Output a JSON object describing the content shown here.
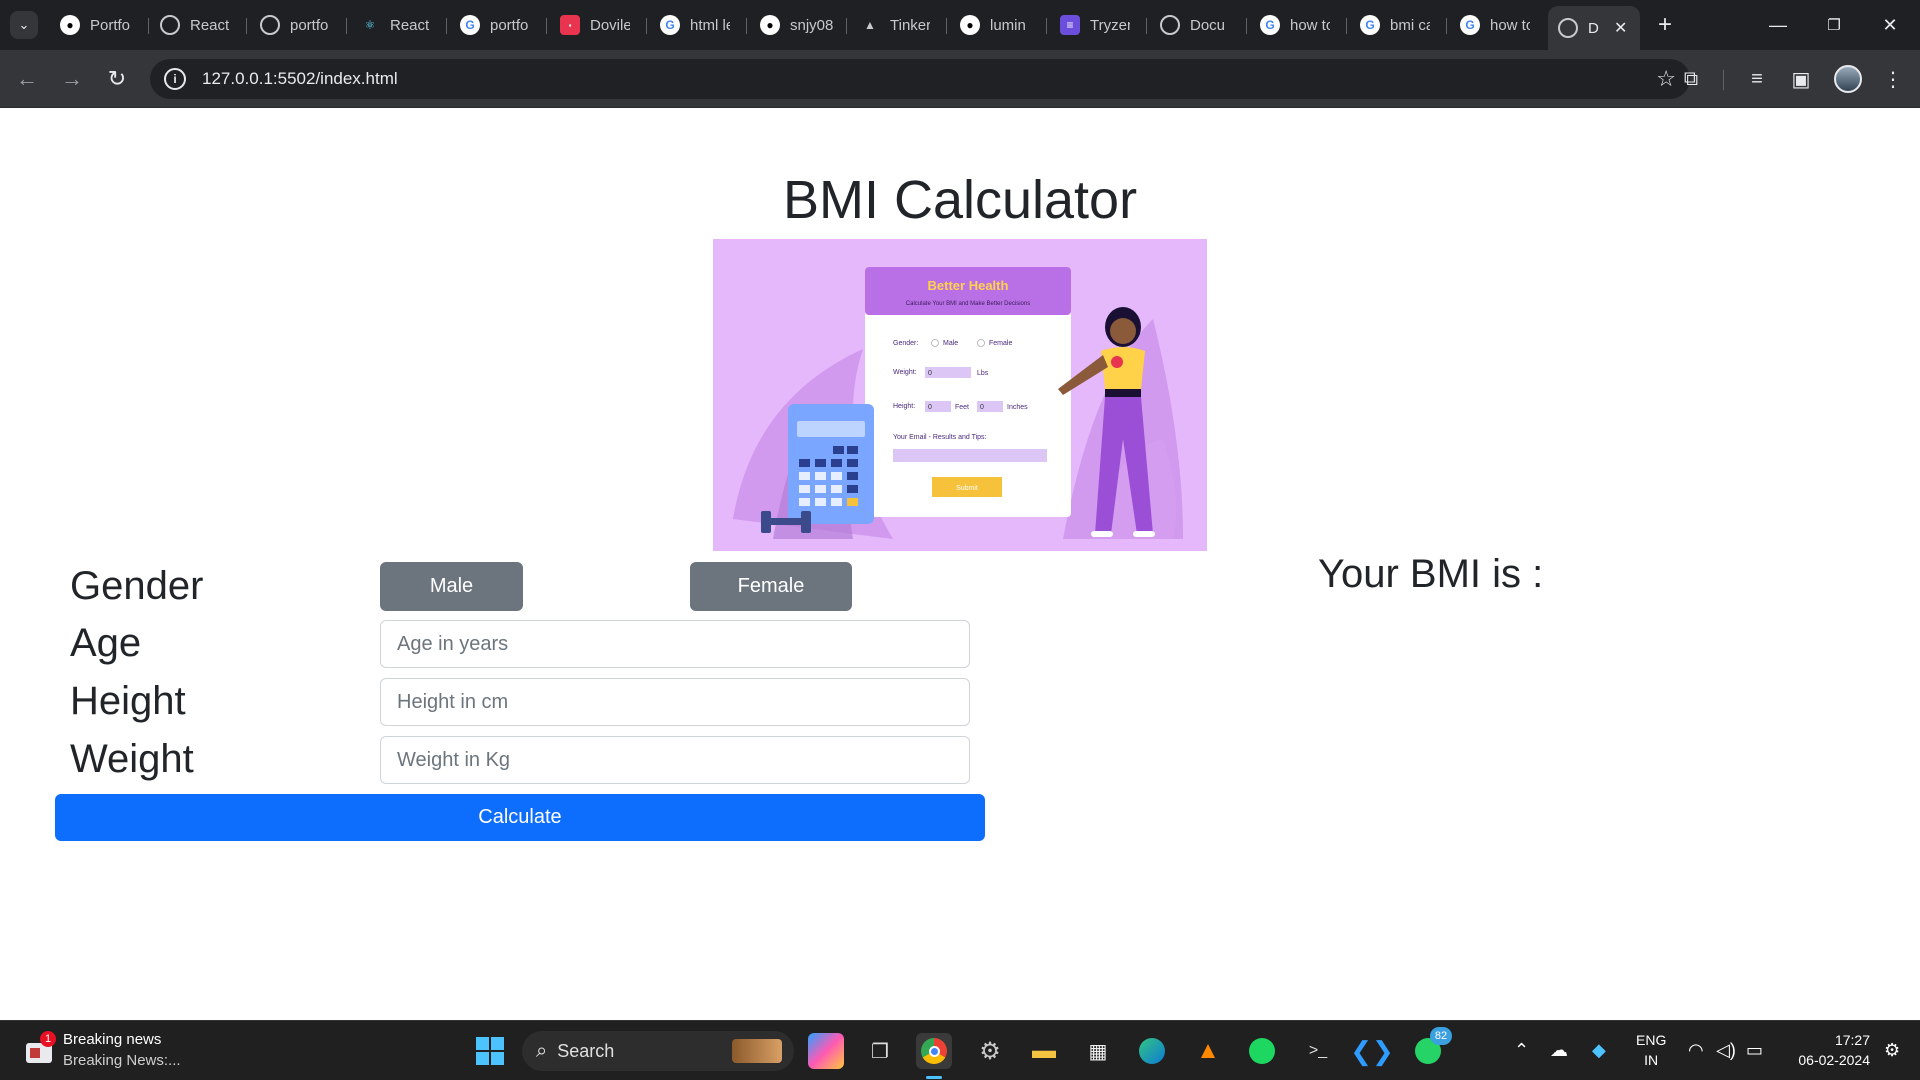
{
  "browser": {
    "tabs": [
      {
        "title": "Portfo",
        "icon": "github-icon"
      },
      {
        "title": "React",
        "icon": "globe-icon"
      },
      {
        "title": "portfo",
        "icon": "globe-icon"
      },
      {
        "title": "React",
        "icon": "react-icon"
      },
      {
        "title": "portfo",
        "icon": "google-icon"
      },
      {
        "title": "Dovile",
        "icon": "app-icon"
      },
      {
        "title": "html le",
        "icon": "google-icon"
      },
      {
        "title": "snjy08",
        "icon": "github-icon"
      },
      {
        "title": "Tinker",
        "icon": "cap-icon"
      },
      {
        "title": "lumin",
        "icon": "github-icon"
      },
      {
        "title": "Tryzen",
        "icon": "list-icon"
      },
      {
        "title": "Docu",
        "icon": "globe-icon"
      },
      {
        "title": "how to",
        "icon": "google-icon"
      },
      {
        "title": "bmi ca",
        "icon": "google-icon"
      },
      {
        "title": "how to",
        "icon": "google-icon"
      },
      {
        "title": "D",
        "icon": "globe-icon"
      }
    ],
    "url": "127.0.0.1:5502/index.html"
  },
  "page": {
    "title": "BMI Calculator",
    "hero": {
      "card_title": "Better Health",
      "card_subtitle": "Calculate Your BMI and Make Better Decisions",
      "gender_label": "Gender:",
      "male": "Male",
      "female": "Female",
      "weight_label": "Weight:",
      "weight_value": "0",
      "weight_unit": "Lbs",
      "height_label": "Height:",
      "feet_value": "0",
      "feet_unit": "Feet",
      "inch_value": "0",
      "inch_unit": "Inches",
      "email_label": "Your Email - Results and Tips:",
      "submit": "Submit"
    },
    "form": {
      "gender_label": "Gender",
      "age_label": "Age",
      "height_label": "Height",
      "weight_label": "Weight",
      "male_button": "Male",
      "female_button": "Female",
      "age_placeholder": "Age in years",
      "height_placeholder": "Height in cm",
      "weight_placeholder": "Weight in Kg",
      "calculate_button": "Calculate"
    },
    "result_label": "Your BMI is :"
  },
  "taskbar": {
    "news_title": "Breaking news",
    "news_sub": "Breaking News:...",
    "news_badge": "1",
    "search_label": "Search",
    "whatsapp_badge": "82",
    "lang_top": "ENG",
    "lang_bottom": "IN",
    "time": "17:27",
    "date": "06-02-2024"
  },
  "colors": {
    "primary": "#0d6efd",
    "secondary": "#6c757d",
    "hero_bg": "#e5b7fb"
  }
}
